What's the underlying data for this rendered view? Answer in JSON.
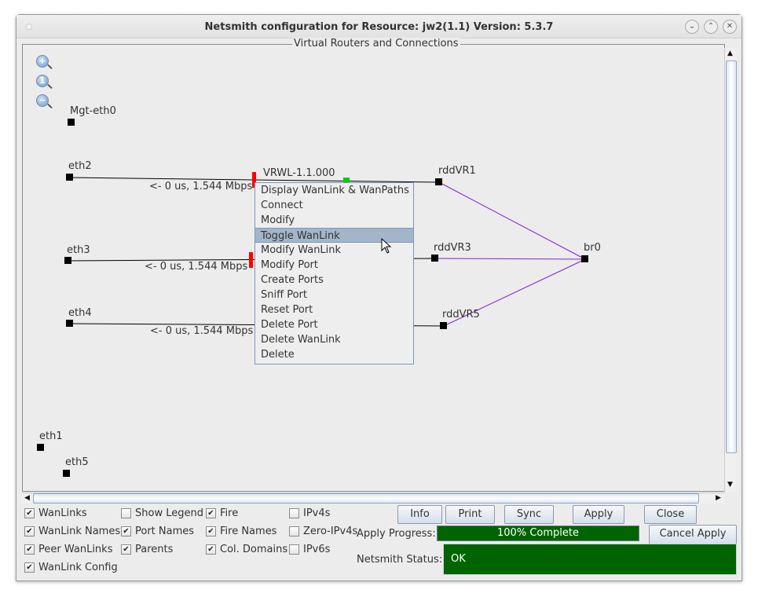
{
  "window": {
    "title": "Netsmith configuration for Resource:  jw2(1.1)  Version: 5.3.7",
    "controls": [
      "minimize",
      "maximize",
      "close"
    ]
  },
  "panel": {
    "title": "Virtual Routers and Connections"
  },
  "zoom_icons": [
    "zoom-in-icon",
    "zoom-reset-icon",
    "zoom-out-icon"
  ],
  "diagram": {
    "ports": [
      "Mgt-eth0",
      "eth2",
      "eth3",
      "eth4",
      "eth1",
      "eth5"
    ],
    "routers": [
      "rddVR1",
      "rddVR3",
      "rddVR5",
      "br0"
    ],
    "wanlink_name": "VRWL-1.1.000",
    "link_labels": [
      "<- 0 us, 1.544 Mbps",
      "<- 0 us, 1.544 Mbps",
      "<- 0 us, 1.544 Mbps"
    ],
    "colors": {
      "wanlink_end": "#ff0000",
      "wanlink_mid": "#00cc00",
      "router_link": "#7f1fdf"
    }
  },
  "context_menu": {
    "items": [
      "Display WanLink & WanPaths",
      "Connect",
      "Modify",
      "Toggle WanLink",
      "Modify WanLink",
      "Modify Port",
      "Create Ports",
      "Sniff Port",
      "Reset Port",
      "Delete Port",
      "Delete WanLink",
      "Delete"
    ],
    "highlighted": "Toggle WanLink"
  },
  "checkboxes": [
    {
      "label": "WanLinks",
      "checked": true
    },
    {
      "label": "WanLink Names",
      "checked": true
    },
    {
      "label": "Peer WanLinks",
      "checked": true
    },
    {
      "label": "WanLink Config",
      "checked": true
    },
    {
      "label": "Show Legend",
      "checked": false
    },
    {
      "label": "Port Names",
      "checked": true
    },
    {
      "label": "Parents",
      "checked": true
    },
    {
      "label": "Fire",
      "checked": true
    },
    {
      "label": "Fire Names",
      "checked": true
    },
    {
      "label": "Col. Domains",
      "checked": true
    },
    {
      "label": "IPv4s",
      "checked": false
    },
    {
      "label": "Zero-IPv4s",
      "checked": false
    },
    {
      "label": "IPv6s",
      "checked": false
    }
  ],
  "buttons": {
    "info": "Info",
    "print": "Print",
    "sync": "Sync",
    "apply": "Apply",
    "close": "Close",
    "cancel_apply": "Cancel Apply"
  },
  "progress": {
    "label": "Apply Progress:",
    "text": "100% Complete",
    "percent": 100
  },
  "status": {
    "label": "Netsmith Status:",
    "text": "OK",
    "color": "#006400"
  }
}
